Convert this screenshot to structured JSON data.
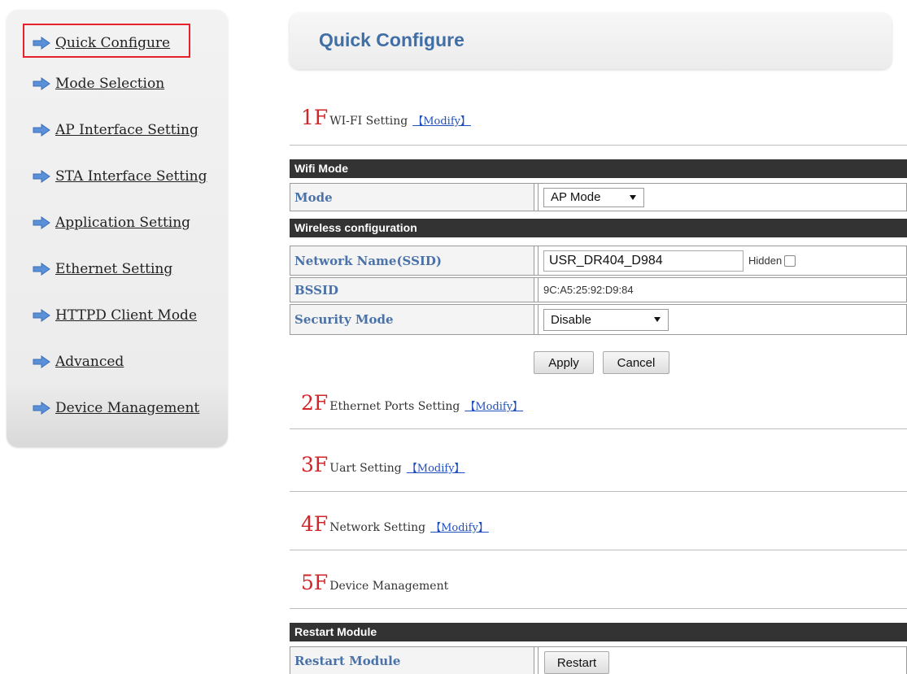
{
  "sidebar": {
    "items": [
      {
        "label": "Quick Configure"
      },
      {
        "label": "Mode Selection"
      },
      {
        "label": "AP Interface Setting"
      },
      {
        "label": "STA Interface Setting"
      },
      {
        "label": "Application Setting"
      },
      {
        "label": "Ethernet Setting"
      },
      {
        "label": "HTTPD Client Mode"
      },
      {
        "label": "Advanced"
      },
      {
        "label": "Device Management"
      }
    ]
  },
  "header": {
    "title": "Quick Configure"
  },
  "sections": [
    {
      "floor": "1F",
      "title": "WI-FI Setting",
      "modify": "【Modify】"
    },
    {
      "floor": "2F",
      "title": "Ethernet Ports Setting",
      "modify": "【Modify】"
    },
    {
      "floor": "3F",
      "title": "Uart Setting",
      "modify": "【Modify】"
    },
    {
      "floor": "4F",
      "title": "Network Setting",
      "modify": "【Modify】"
    },
    {
      "floor": "5F",
      "title": "Device Management"
    }
  ],
  "wifi": {
    "mode_header": "Wifi Mode",
    "mode_label": "Mode",
    "mode_value": "AP Mode",
    "wireless_header": "Wireless configuration",
    "ssid_label": "Network Name(SSID)",
    "ssid_value": "USR_DR404_D984",
    "hidden_label": "Hidden",
    "bssid_label": "BSSID",
    "bssid_value": "9C:A5:25:92:D9:84",
    "security_label": "Security Mode",
    "security_value": "Disable",
    "apply_label": "Apply",
    "cancel_label": "Cancel"
  },
  "restart": {
    "header": "Restart Module",
    "label": "Restart Module",
    "button": "Restart"
  },
  "colors": {
    "accent": "#3f6fa6",
    "floor_red": "#d0262a",
    "highlight_red": "#e8202a",
    "link_blue": "#1f4fbd",
    "table_header": "#333333"
  },
  "icons": {
    "nav": "arrow-right-icon",
    "dropdown": "caret-down-icon"
  }
}
